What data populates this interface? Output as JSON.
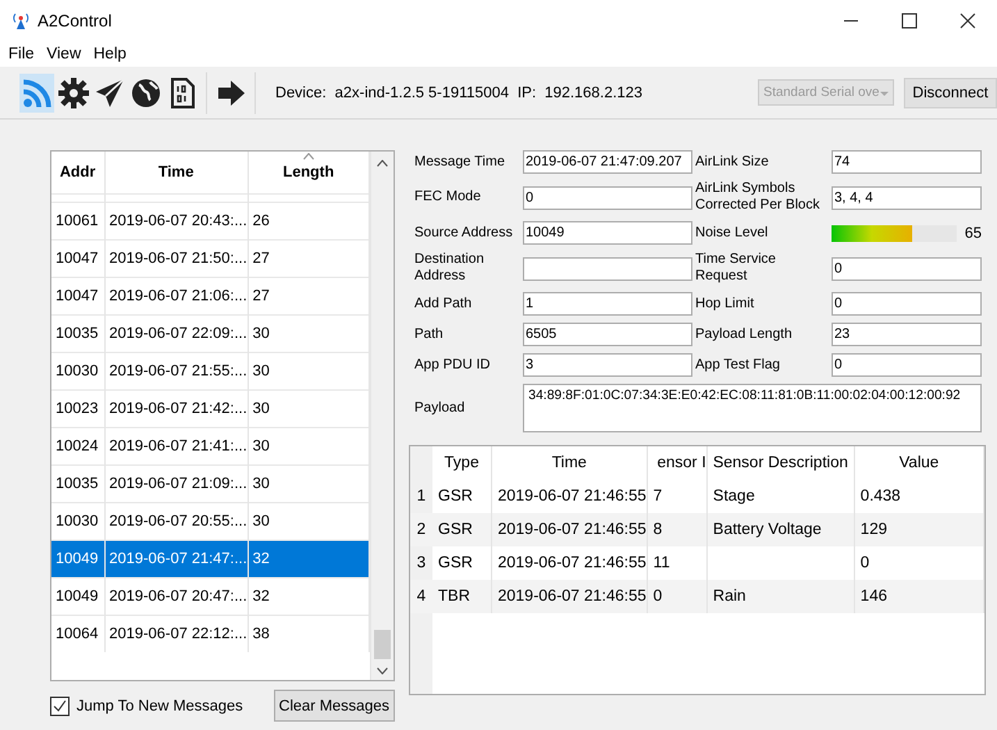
{
  "window": {
    "title": "A2Control"
  },
  "menu": [
    "File",
    "View",
    "Help"
  ],
  "toolbar": {
    "tools": [
      {
        "kind": "wifi",
        "selected": true
      },
      {
        "kind": "gear",
        "selected": false
      },
      {
        "kind": "send",
        "selected": false
      },
      {
        "kind": "globe",
        "selected": false
      },
      {
        "kind": "binary",
        "selected": false
      },
      {
        "kind": "exit",
        "selected": false
      }
    ],
    "device_label": "Device:",
    "device": "a2x-ind-1.2.5 5-19115004",
    "ip_label": "IP:",
    "ip": "192.168.2.123",
    "port": "Standard Serial ove",
    "disconnect": "Disconnect"
  },
  "messages": {
    "columns": [
      {
        "label": "Addr",
        "sorted": false
      },
      {
        "label": "Time",
        "sorted": false
      },
      {
        "label": "Length",
        "sorted": true
      }
    ],
    "rows": [
      {
        "addr": "10061",
        "time": "2019-06-07 20:43:...",
        "length": "26",
        "selected": false
      },
      {
        "addr": "10047",
        "time": "2019-06-07 21:50:...",
        "length": "27",
        "selected": false
      },
      {
        "addr": "10047",
        "time": "2019-06-07 21:06:...",
        "length": "27",
        "selected": false
      },
      {
        "addr": "10035",
        "time": "2019-06-07 22:09:...",
        "length": "30",
        "selected": false
      },
      {
        "addr": "10030",
        "time": "2019-06-07 21:55:...",
        "length": "30",
        "selected": false
      },
      {
        "addr": "10023",
        "time": "2019-06-07 21:42:...",
        "length": "30",
        "selected": false
      },
      {
        "addr": "10024",
        "time": "2019-06-07 21:41:...",
        "length": "30",
        "selected": false
      },
      {
        "addr": "10035",
        "time": "2019-06-07 21:09:...",
        "length": "30",
        "selected": false
      },
      {
        "addr": "10030",
        "time": "2019-06-07 20:55:...",
        "length": "30",
        "selected": false
      },
      {
        "addr": "10049",
        "time": "2019-06-07 21:47:...",
        "length": "32",
        "selected": true
      },
      {
        "addr": "10049",
        "time": "2019-06-07 20:47:...",
        "length": "32",
        "selected": false
      },
      {
        "addr": "10064",
        "time": "2019-06-07 22:12:...",
        "length": "38",
        "selected": false
      }
    ],
    "jump": {
      "label": "Jump To New Messages",
      "checked": true
    },
    "clear": "Clear Messages"
  },
  "details": {
    "fields": [
      {
        "kind": "text",
        "label": "Message Time",
        "value": "2019-06-07 21:47:09.207"
      },
      {
        "kind": "text",
        "label": "AirLink Size",
        "value": "74"
      },
      {
        "kind": "text",
        "label": "FEC Mode",
        "value": "0"
      },
      {
        "kind": "text",
        "label": "AirLink Symbols Corrected Per Block",
        "value": "3, 4, 4"
      },
      {
        "kind": "text",
        "label": "Source Address",
        "value": "10049"
      },
      {
        "kind": "meter",
        "label": "Noise Level",
        "level": 0.65,
        "reading": "65"
      },
      {
        "kind": "text",
        "label": "Destination Address"
      },
      {
        "kind": "text",
        "label": "Time Service Request",
        "value": "0"
      },
      {
        "kind": "text",
        "label": "Add Path",
        "value": "1"
      },
      {
        "kind": "text",
        "label": "Hop Limit",
        "value": "0"
      },
      {
        "kind": "text",
        "label": "Path",
        "value": "6505"
      },
      {
        "kind": "text",
        "label": "Payload Length",
        "value": "23"
      },
      {
        "kind": "text",
        "label": "App PDU ID",
        "value": "3"
      },
      {
        "kind": "text",
        "label": "App Test Flag",
        "value": "0"
      }
    ],
    "payload": {
      "label": "Payload",
      "value": "34:89:8F:01:0C:07:34:3E:E0:42:EC:08:11:81:0B:11:00:02:04:00:12:00:92"
    }
  },
  "sensors": {
    "columns": [
      "Type",
      "Time",
      "ensor I",
      "Sensor Description",
      "Value"
    ],
    "rows": [
      {
        "number": "1",
        "type": "GSR",
        "time": "2019-06-07 21:46:55",
        "column_3": "7",
        "description": "Stage",
        "value": "0.438"
      },
      {
        "number": "2",
        "type": "GSR",
        "time": "2019-06-07 21:46:55",
        "column_3": "8",
        "description": "Battery Voltage",
        "value": "129"
      },
      {
        "number": "3",
        "type": "GSR",
        "time": "2019-06-07 21:46:55",
        "column_3": "11",
        "value": "0"
      },
      {
        "number": "4",
        "type": "TBR",
        "time": "2019-06-07 21:46:55",
        "column_3": "0",
        "description": "Rain",
        "value": "146"
      }
    ]
  }
}
